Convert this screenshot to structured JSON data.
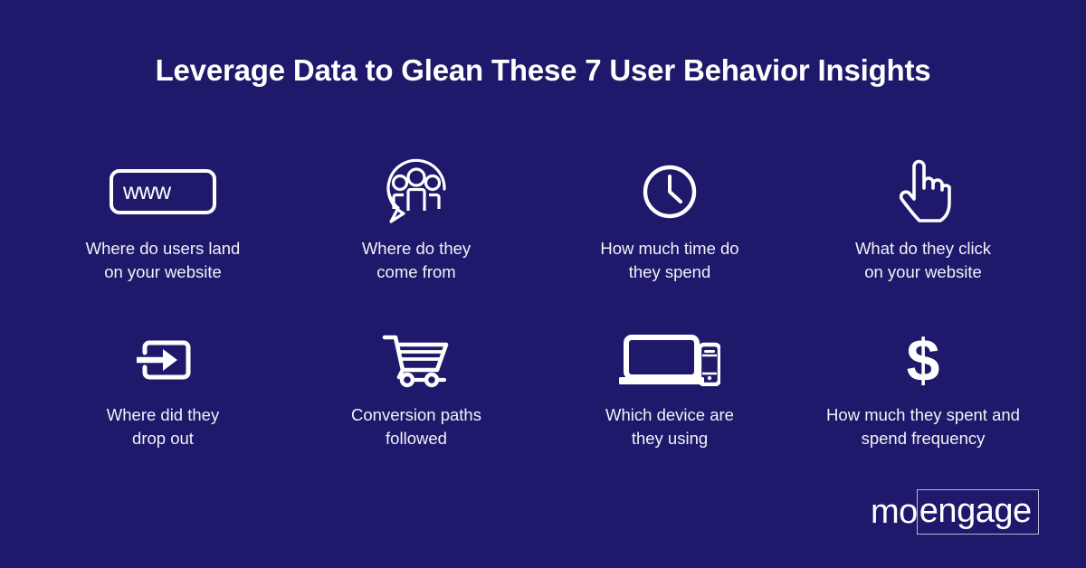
{
  "background_color": "#1e196b",
  "text_color": "#f2f2f7",
  "accent_color": "#ffffff",
  "headline": "Leverage Data to Glean These 7 User Behavior Insights",
  "insights": [
    {
      "icon": "browser-www-icon",
      "icon_text": "www",
      "label": "Where do users land\non your website"
    },
    {
      "icon": "people-speech-bubble-icon",
      "label": "Where do they\ncome from"
    },
    {
      "icon": "clock-icon",
      "label": "How much time do\nthey spend"
    },
    {
      "icon": "pointing-hand-cursor-icon",
      "label": "What do they click\non your website"
    },
    {
      "icon": "exit-arrow-icon",
      "label": "Where did they\ndrop out"
    },
    {
      "icon": "shopping-cart-icon",
      "label": "Conversion paths\nfollowed"
    },
    {
      "icon": "laptop-and-phone-icon",
      "label": "Which device are\nthey using"
    },
    {
      "icon": "dollar-sign-icon",
      "label": "How much they spent and\nspend frequency"
    }
  ],
  "logo": {
    "part1": "mo",
    "part2": "engage"
  }
}
